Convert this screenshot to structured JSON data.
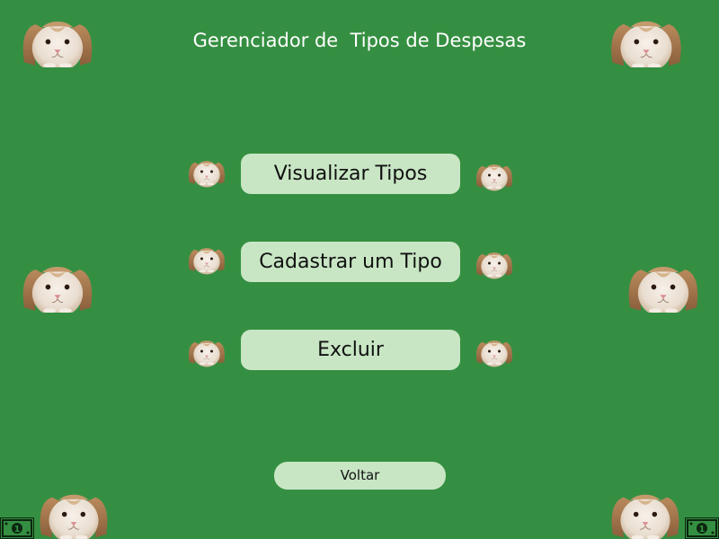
{
  "header": {
    "title": "Gerenciador de  Tipos de Despesas"
  },
  "menu": {
    "items": [
      {
        "label": "Visualizar Tipos"
      },
      {
        "label": "Cadastrar um Tipo"
      },
      {
        "label": "Excluir"
      }
    ]
  },
  "footer": {
    "back_label": "Voltar"
  },
  "colors": {
    "background": "#358f42",
    "button": "#c8e6c4",
    "title_text": "#ffffff",
    "button_text": "#111111"
  },
  "icons": {
    "decoration": "bunny-icon",
    "corner": "money-bill-icon"
  }
}
